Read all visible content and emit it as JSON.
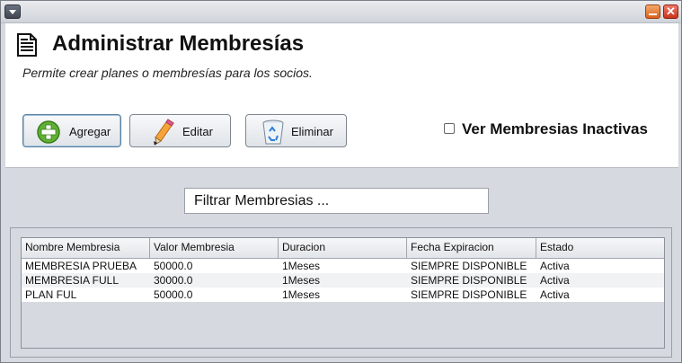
{
  "window": {
    "menu_icon": "chevron-down-icon",
    "minimize_icon": "minimize-icon",
    "close_icon": "close-icon",
    "close_glyph": "✕"
  },
  "header": {
    "icon": "document-icon",
    "title": "Administrar Membresías",
    "subtitle": "Permite crear planes o membresías para los socios."
  },
  "toolbar": {
    "add_label": "Agregar",
    "edit_label": "Editar",
    "delete_label": "Eliminar",
    "inactive_checkbox_label": "Ver Membresias Inactivas",
    "inactive_checked": false
  },
  "filter": {
    "value": "Filtrar Membresias ..."
  },
  "table": {
    "columns": [
      "Nombre Membresia",
      "Valor Membresia",
      "Duracion",
      "Fecha Expiracion",
      "Estado"
    ],
    "rows": [
      [
        "MEMBRESIA PRUEBA",
        "50000.0",
        "1Meses",
        "SIEMPRE DISPONIBLE",
        "Activa"
      ],
      [
        "MEMBRESIA FULL",
        "30000.0",
        "1Meses",
        "SIEMPRE DISPONIBLE",
        "Activa"
      ],
      [
        "PLAN FUL",
        "50000.0",
        "1Meses",
        "SIEMPRE DISPONIBLE",
        "Activa"
      ]
    ]
  }
}
